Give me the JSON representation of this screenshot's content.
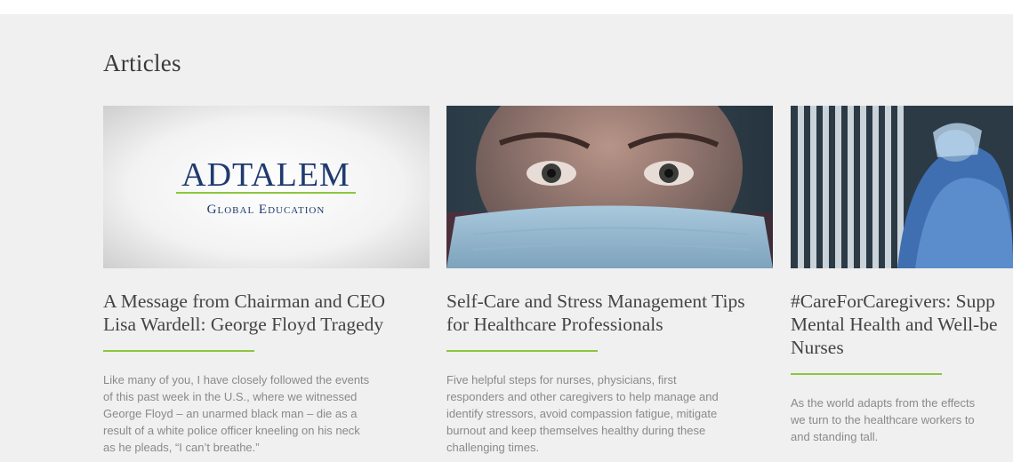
{
  "section": {
    "title": "Articles"
  },
  "colors": {
    "background": "#f0f0f0",
    "accent": "#8cc63f",
    "title_text": "#444444",
    "body_text": "#8a8a8a",
    "logo_navy": "#1f3a6e"
  },
  "articles": [
    {
      "image": "adtalem-logo",
      "logo": {
        "line1": "ADTALEM",
        "line2": "Global Education"
      },
      "title_lines": [
        "A Message from Chairman and CEO",
        "Lisa Wardell: George Floyd Tragedy"
      ],
      "description_lines": [
        "Like many of you, I have closely followed the events",
        "of this past week in the U.S., where we witnessed",
        "George Floyd – an unarmed black man – die as a",
        "result of a white police officer kneeling on his neck",
        "as he pleads, “I can’t breathe.”"
      ]
    },
    {
      "image": "masked-healthcare-worker-photo",
      "title_lines": [
        "Self-Care and Stress Management Tips",
        "for Healthcare Professionals"
      ],
      "description_lines": [
        "Five helpful steps for nurses, physicians, first",
        "responders and other caregivers to help manage and",
        "identify stressors, avoid compassion fatigue, mitigate",
        "burnout and keep themselves healthy during these",
        "challenging times."
      ]
    },
    {
      "image": "nurses-hugging-photo",
      "title_lines": [
        "#CareForCaregivers: Supp",
        "Mental Health and Well-be",
        "Nurses"
      ],
      "description_lines": [
        "As the world adapts from the effects",
        "we turn to the healthcare workers to",
        "and standing tall."
      ]
    }
  ]
}
